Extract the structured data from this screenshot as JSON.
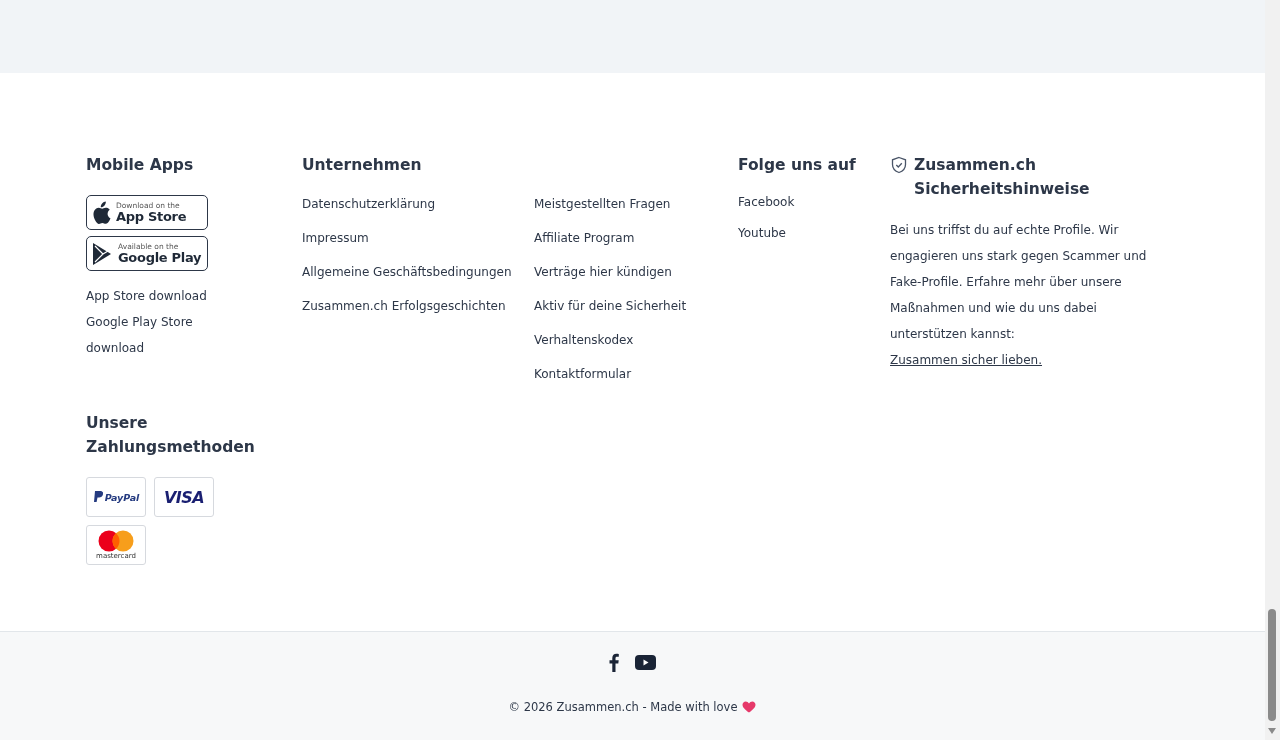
{
  "mobile_apps": {
    "heading": "Mobile Apps",
    "badges": [
      {
        "kind": "apple",
        "small": "Download on the",
        "big": "App Store"
      },
      {
        "kind": "google",
        "small": "Available on the",
        "big": "Google Play"
      }
    ],
    "links": [
      "App Store download",
      "Google Play Store download"
    ]
  },
  "payment": {
    "heading": "Unsere Zahlungsmethoden",
    "methods": [
      {
        "kind": "paypal",
        "label": "PayPal"
      },
      {
        "kind": "visa",
        "label": "VISA"
      },
      {
        "kind": "mastercard",
        "label": "mastercard"
      }
    ]
  },
  "company": {
    "heading": "Unternehmen",
    "columns": [
      [
        "Datenschutzerklärung",
        "Impressum",
        "Allgemeine Geschäftsbedingungen",
        "Zusammen.ch Erfolgsgeschichten"
      ],
      [
        "Meistgestellten Fragen",
        "Affiliate Program",
        "Verträge hier kündigen",
        "Aktiv für deine Sicherheit",
        "Verhaltenskodex",
        "Kontaktformular"
      ]
    ]
  },
  "social": {
    "heading": "Folge uns auf",
    "links": [
      "Facebook",
      "Youtube"
    ]
  },
  "safety": {
    "heading": "Zusammen.ch Sicherheitshinweise",
    "text": "Bei uns triffst du auf echte Profile. Wir engagieren uns stark gegen Scammer und Fake-Profile. Erfahre mehr über unsere Maßnahmen und wie du uns dabei unterstützen kannst: ",
    "link": "Zusammen sicher lieben."
  },
  "bottom": {
    "icons": [
      {
        "kind": "facebook"
      },
      {
        "kind": "youtube"
      }
    ],
    "copyright": "© 2026 Zusammen.ch - Made with love"
  }
}
